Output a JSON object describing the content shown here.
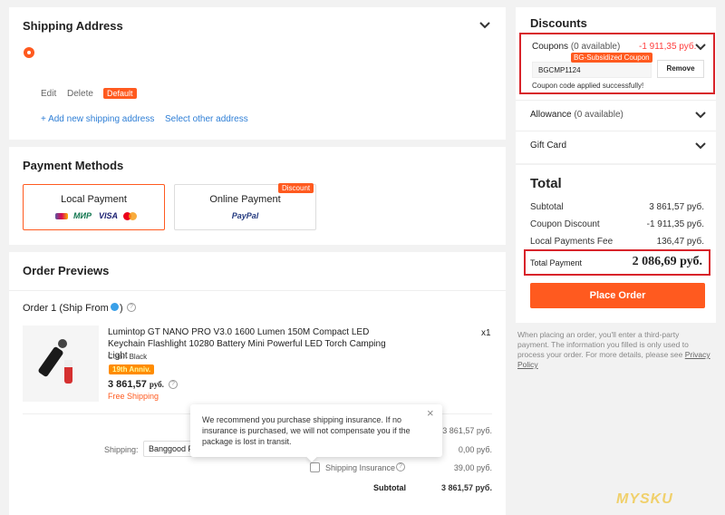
{
  "shipping": {
    "title": "Shipping Address",
    "edit": "Edit",
    "delete": "Delete",
    "default_badge": "Default",
    "add_new": "+ Add new shipping address",
    "select_other": "Select other address"
  },
  "payment": {
    "title": "Payment Methods",
    "local": "Local Payment",
    "local_logos": [
      "МИР",
      "VISA"
    ],
    "online": "Online Payment",
    "online_logo": "PayPal",
    "discount_badge": "Discount"
  },
  "order": {
    "title": "Order Previews",
    "order_label": "Order 1 (Ship From",
    "product_name": "Lumintop GT NANO PRO V3.0 1600 Lumen 150M Compact LED Keychain Flashlight 10280 Battery Mini Powerful LED Torch Camping Light",
    "color_label": "Color:",
    "color_value": "Black",
    "anniv_badge": "19th Anniv.",
    "price": "3 861,57",
    "currency": "руб.",
    "free_shipping": "Free Shipping",
    "qty": "x1",
    "shipping_label": "Shipping:",
    "shipping_select": "Banggood F",
    "tooltip": "We recommend you purchase shipping insurance. If no insurance is purchased, we will not compensate you if the package is lost in transit.",
    "line1": "3 861,57 руб.",
    "line2": "0,00 руб.",
    "insurance_label": "Shipping Insurance",
    "insurance_value": "39,00 руб.",
    "subtotal_label": "Subtotal",
    "subtotal_value": "3 861,57 руб."
  },
  "discounts": {
    "title": "Discounts",
    "coupons_label": "Coupons",
    "coupons_count": "(0 available)",
    "coupons_amount": "-1 911,35 руб.",
    "coupon_badge": "BG-Subsidized Coupon",
    "coupon_code": "BGCMP1124",
    "remove": "Remove",
    "success": "Coupon code applied successfully!",
    "allowance_label": "Allowance",
    "allowance_count": "(0 available)",
    "gift_card": "Gift Card"
  },
  "total": {
    "title": "Total",
    "subtotal_label": "Subtotal",
    "subtotal_value": "3 861,57 руб.",
    "coupon_label": "Coupon Discount",
    "coupon_value": "-1 911,35 руб.",
    "fee_label": "Local Payments Fee",
    "fee_value": "136,47 руб.",
    "payment_label": "Total Payment",
    "payment_value": "2 086,69 руб.",
    "place_order": "Place Order",
    "note": "When placing an order, you'll enter a third-party payment. The information you filled is only used to process your order. For more details, please see",
    "privacy": "Privacy Policy"
  },
  "watermark": "MYSKU",
  "colors": {
    "accent": "#ff5a1f",
    "link": "#2f7fd6",
    "highlight": "#d8232a"
  }
}
